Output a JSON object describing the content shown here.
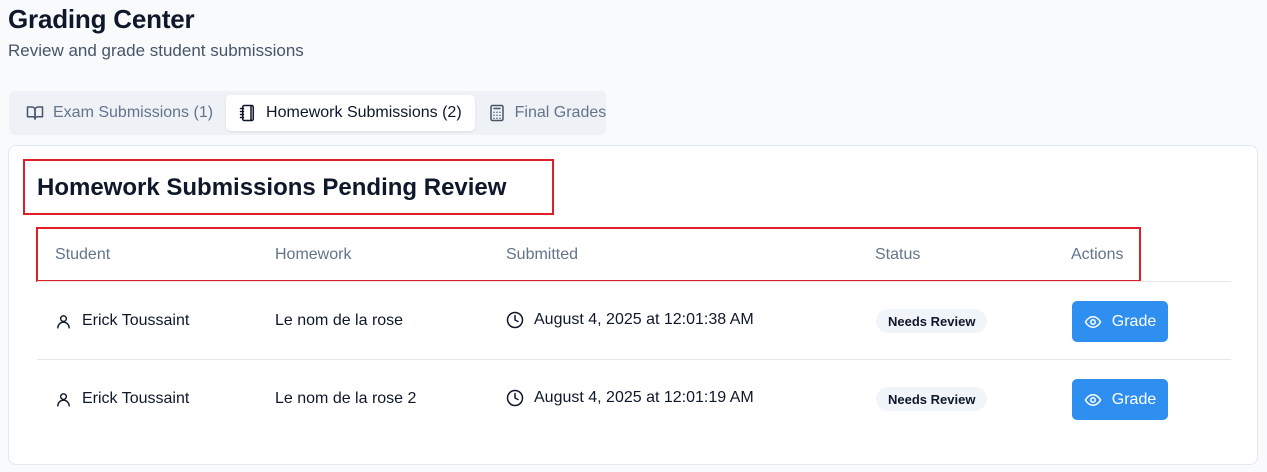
{
  "header": {
    "title": "Grading Center",
    "subtitle": "Review and grade student submissions"
  },
  "tabs": [
    {
      "label": "Exam Submissions (1)",
      "icon": "book-open-icon",
      "active": false
    },
    {
      "label": "Homework Submissions (2)",
      "icon": "notebook-icon",
      "active": true
    },
    {
      "label": "Final Grades",
      "icon": "calculator-icon",
      "active": false
    }
  ],
  "card": {
    "title": "Homework Submissions Pending Review",
    "columns": [
      "Student",
      "Homework",
      "Submitted",
      "Status",
      "Actions"
    ],
    "rows": [
      {
        "student": "Erick Toussaint",
        "homework": "Le nom de la rose",
        "submitted": "August 4, 2025 at 12:01:38 AM",
        "status": "Needs Review",
        "action": "Grade"
      },
      {
        "student": "Erick Toussaint",
        "homework": "Le nom de la rose 2",
        "submitted": "August 4, 2025 at 12:01:19 AM",
        "status": "Needs Review",
        "action": "Grade"
      }
    ]
  },
  "colors": {
    "accent": "#2e8ff0",
    "highlight": "#e11d26"
  }
}
